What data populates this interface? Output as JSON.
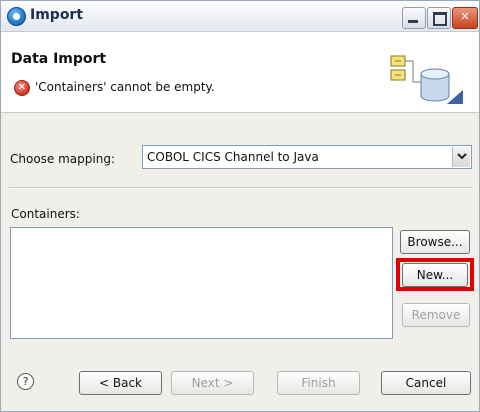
{
  "window": {
    "title": "Import",
    "controls": [
      "minimize",
      "maximize",
      "close"
    ]
  },
  "header": {
    "title": "Data Import",
    "error_message": "'Containers' cannot be empty."
  },
  "mapping": {
    "label": "Choose mapping:",
    "selected": "COBOL CICS Channel to Java"
  },
  "containers": {
    "label": "Containers:",
    "items": [],
    "buttons": {
      "browse": "Browse...",
      "new": "New...",
      "remove": "Remove"
    }
  },
  "footer": {
    "help": "?",
    "back": "< Back",
    "next": "Next >",
    "finish": "Finish",
    "cancel": "Cancel"
  },
  "colors": {
    "highlight": "#e00000",
    "error": "#d2311e",
    "dialog_bg": "#f0efea"
  },
  "icons": {
    "app": "import-icon",
    "error": "error-icon",
    "wizard": "data-import-wizard-icon",
    "help": "help-icon"
  }
}
